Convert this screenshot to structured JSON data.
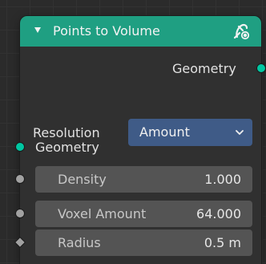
{
  "node": {
    "title": "Points to Volume",
    "accent_color": "#1f9f82",
    "header_icon": "geometry-nodes-icon",
    "collapse_icon": "collapse-triangle-icon"
  },
  "outputs": {
    "geometry_label": "Geometry",
    "socket_color": "#00c7a2"
  },
  "resolution": {
    "label": "Resolution",
    "selected": "Amount",
    "dropdown_color": "#3f5b87"
  },
  "inputs": {
    "geometry_label": "Geometry",
    "density": {
      "label": "Density",
      "value": "1.000"
    },
    "voxel_amount": {
      "label": "Voxel Amount",
      "value": "64.000"
    },
    "radius": {
      "label": "Radius",
      "value": "0.5 m"
    }
  }
}
